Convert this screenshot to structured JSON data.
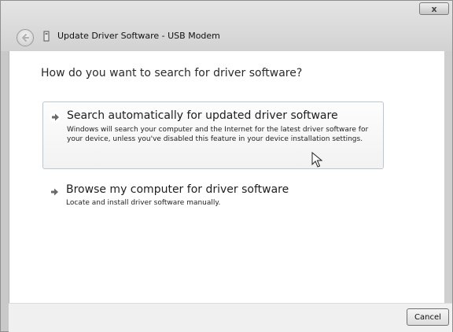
{
  "window": {
    "title": "Update Driver Software - USB Modem",
    "close_label": "x"
  },
  "icons": {
    "back": "back-arrow-icon",
    "wizard": "device-icon",
    "option_arrow": "green-arrow-icon",
    "cursor": "mouse-cursor-icon"
  },
  "main": {
    "heading": "How do you want to search for driver software?",
    "options": [
      {
        "title": "Search automatically for updated driver software",
        "description": "Windows will search your computer and the Internet for the latest driver software for your device, unless you've disabled this feature in your device installation settings."
      },
      {
        "title": "Browse my computer for driver software",
        "description": "Locate and install driver software manually."
      }
    ]
  },
  "footer": {
    "cancel_label": "Cancel"
  }
}
